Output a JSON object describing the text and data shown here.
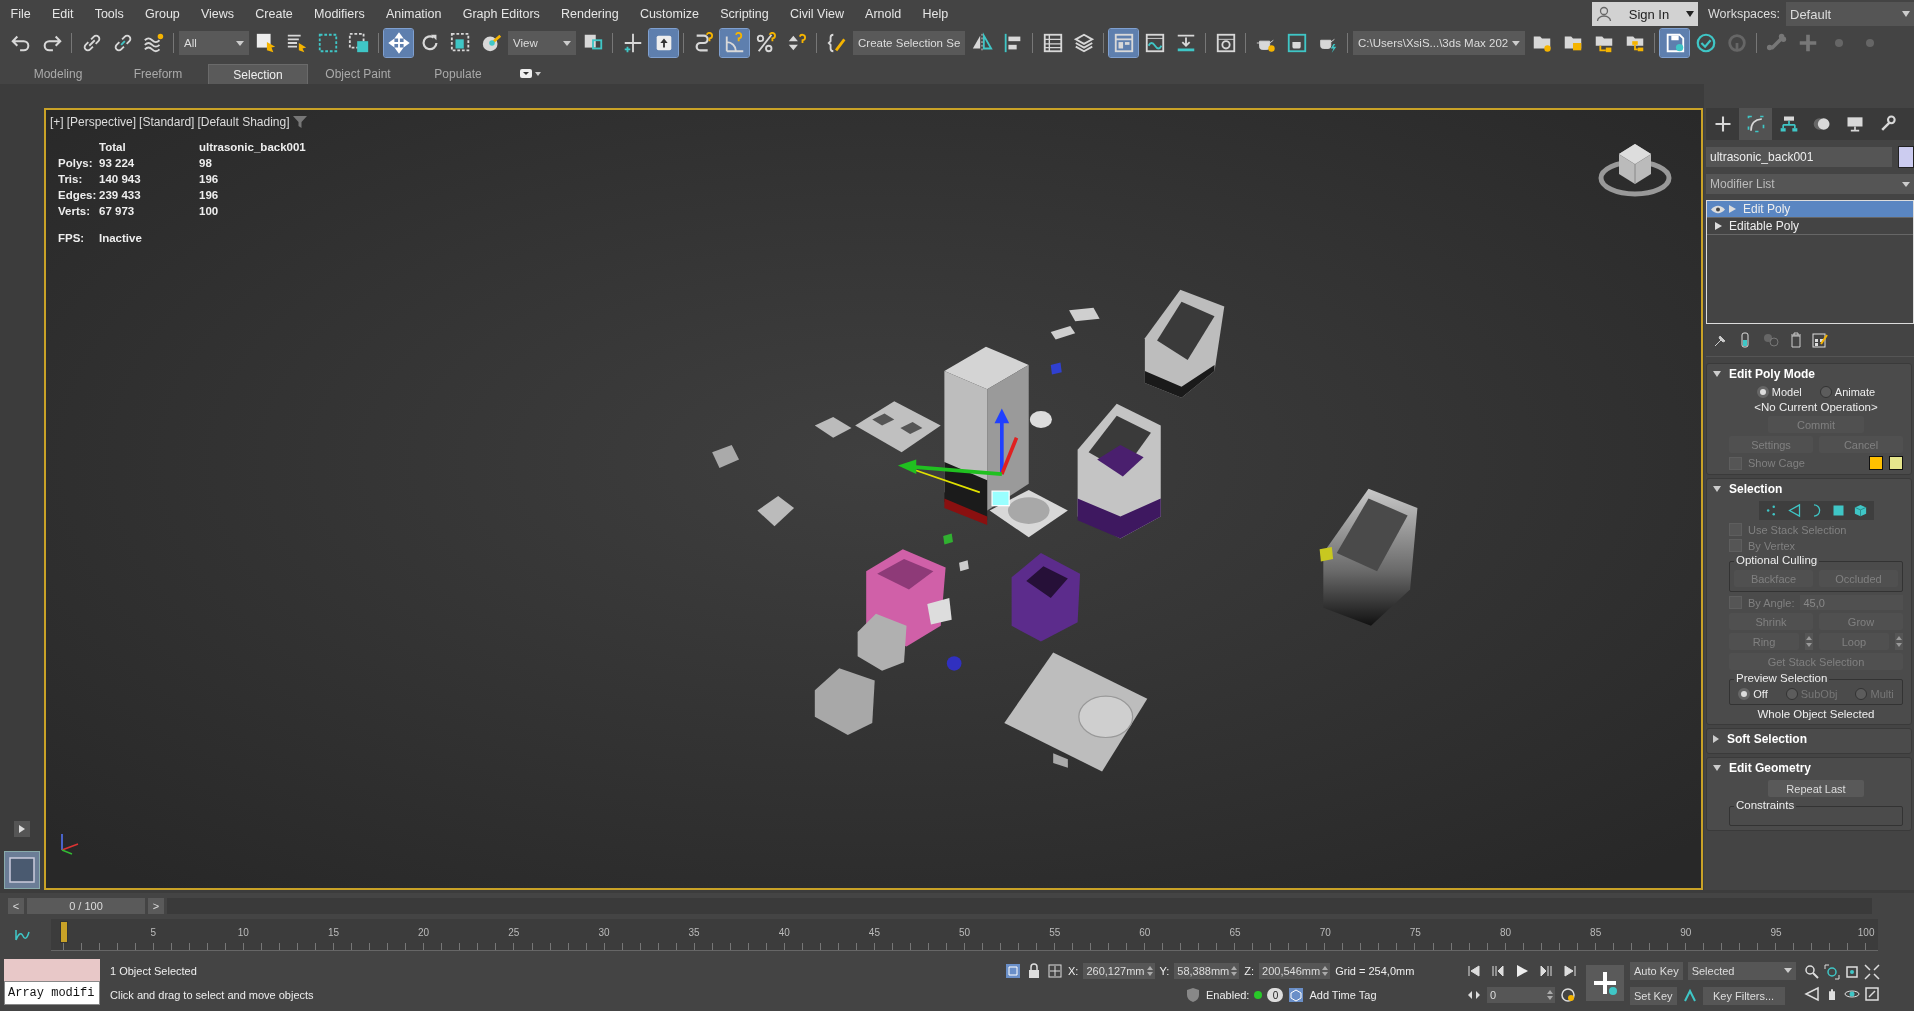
{
  "menu_bar": {
    "items": [
      "File",
      "Edit",
      "Tools",
      "Group",
      "Views",
      "Create",
      "Modifiers",
      "Animation",
      "Graph Editors",
      "Rendering",
      "Customize",
      "Scripting",
      "Civil View",
      "Arnold",
      "Help"
    ],
    "sign_in": "Sign In",
    "workspaces_label": "Workspaces:",
    "workspace": "Default"
  },
  "toolbar": [
    {
      "kind": "undo",
      "selected": false
    },
    {
      "kind": "redo",
      "selected": false
    },
    {
      "kind": "separator"
    },
    {
      "kind": "link",
      "selected": false
    },
    {
      "kind": "unlink",
      "selected": false
    },
    {
      "kind": "bind",
      "selected": false
    },
    {
      "kind": "separator"
    },
    {
      "kind": "dropdown",
      "value": "All"
    },
    {
      "kind": "select",
      "selected": false
    },
    {
      "kind": "select-by-name",
      "selected": false
    },
    {
      "kind": "rect-region",
      "selected": false
    },
    {
      "kind": "window-crossing",
      "selected": false
    },
    {
      "kind": "separator"
    },
    {
      "kind": "move",
      "selected": true
    },
    {
      "kind": "rotate",
      "selected": false
    },
    {
      "kind": "scale",
      "selected": false
    },
    {
      "kind": "place",
      "selected": false
    },
    {
      "kind": "dropdown",
      "value": "View"
    },
    {
      "kind": "pivot",
      "selected": false
    },
    {
      "kind": "separator"
    },
    {
      "kind": "axis-constraint",
      "selected": false
    },
    {
      "kind": "placement",
      "selected": true
    },
    {
      "kind": "separator"
    },
    {
      "kind": "snap",
      "selected": false
    },
    {
      "kind": "angle-snap",
      "selected": true
    },
    {
      "kind": "percent-snap",
      "selected": false
    },
    {
      "kind": "spinner-snap",
      "selected": false
    },
    {
      "kind": "separator"
    },
    {
      "kind": "named-selection",
      "selected": false
    },
    {
      "kind": "dropdown",
      "value": "Create Selection Se"
    },
    {
      "kind": "mirror",
      "selected": false
    },
    {
      "kind": "align",
      "selected": false
    },
    {
      "kind": "separator"
    },
    {
      "kind": "scene-explorer",
      "selected": false
    },
    {
      "kind": "layer-explorer",
      "selected": false
    },
    {
      "kind": "separator"
    },
    {
      "kind": "ribbon",
      "selected": true
    },
    {
      "kind": "curve-editor",
      "selected": false
    },
    {
      "kind": "schematic",
      "selected": false
    },
    {
      "kind": "separator"
    },
    {
      "kind": "render-setup",
      "selected": false
    },
    {
      "kind": "separator"
    },
    {
      "kind": "teapot-gear",
      "selected": false
    },
    {
      "kind": "teapot-window",
      "selected": false
    },
    {
      "kind": "teapot-bolt",
      "selected": false
    },
    {
      "kind": "separator"
    },
    {
      "kind": "dropdown",
      "value": "C:\\Users\\XsiS...\\3ds Max 202"
    },
    {
      "kind": "folder-gear",
      "selected": false
    },
    {
      "kind": "folder",
      "selected": false
    },
    {
      "kind": "folder-tree",
      "selected": false
    },
    {
      "kind": "folder-branches",
      "selected": false
    },
    {
      "kind": "separator"
    },
    {
      "kind": "floppy",
      "selected": true
    },
    {
      "kind": "check",
      "selected": false
    },
    {
      "kind": "circle-arrow",
      "selected": false
    },
    {
      "kind": "separator"
    },
    {
      "kind": "bone",
      "selected": false
    },
    {
      "kind": "plus",
      "selected": false
    },
    {
      "kind": "dot",
      "selected": false
    },
    {
      "kind": "dot",
      "selected": false
    }
  ],
  "ribbon_tabs": [
    {
      "label": "Modeling",
      "selected": false
    },
    {
      "label": "Freeform",
      "selected": false
    },
    {
      "label": "Selection",
      "selected": true
    },
    {
      "label": "Object Paint",
      "selected": false
    },
    {
      "label": "Populate",
      "selected": false
    }
  ],
  "viewport": {
    "active": true,
    "labels": [
      "[+]",
      "[Perspective]",
      "[Standard]",
      "[Default Shading]"
    ],
    "stats": {
      "columns": [
        "Total",
        "ultrasonic_back001"
      ],
      "rows": [
        {
          "label": "Polys:",
          "total": "93 224",
          "object": "98"
        },
        {
          "label": "Tris:",
          "total": "140 943",
          "object": "196"
        },
        {
          "label": "Edges:",
          "total": "239 433",
          "object": "196"
        },
        {
          "label": "Verts:",
          "total": "67 973",
          "object": "100"
        }
      ],
      "fps_label": "FPS:",
      "fps": "Inactive"
    }
  },
  "command_panel": {
    "tabs": [
      {
        "kind": "create",
        "selected": false
      },
      {
        "kind": "modify",
        "selected": true
      },
      {
        "kind": "hierarchy",
        "selected": false
      },
      {
        "kind": "motion",
        "selected": false
      },
      {
        "kind": "display",
        "selected": false
      },
      {
        "kind": "utilities",
        "selected": false
      }
    ],
    "object_name": "ultrasonic_back001",
    "object_swatch": {
      "color": "#ccccf0"
    },
    "modifier_list": "Modifier List",
    "stack": [
      {
        "label": "Edit Poly",
        "selected": true,
        "visible": true
      },
      {
        "label": "Editable Poly",
        "selected": false,
        "visible": false
      }
    ],
    "rollouts": [
      {
        "title": "Edit Poly Mode",
        "expanded": true,
        "controls": [
          {
            "kind": "radios",
            "options": [
              {
                "label": "Model",
                "selected": true,
                "disabled": false
              },
              {
                "label": "Animate",
                "selected": false,
                "disabled": false
              }
            ]
          },
          {
            "kind": "note",
            "text": "<No Current Operation>"
          },
          {
            "kind": "buttons",
            "items": [
              {
                "label": "Commit",
                "disabled": true
              }
            ]
          },
          {
            "kind": "buttons",
            "items": [
              {
                "label": "Settings",
                "disabled": true
              },
              {
                "label": "Cancel",
                "disabled": true
              }
            ]
          },
          {
            "kind": "checkbox",
            "label": "Show Cage",
            "checked": false,
            "disabled": true,
            "swatches": [
              {
                "color": "#ffc000"
              },
              {
                "color": "#e6e68c"
              }
            ]
          }
        ]
      },
      {
        "title": "Selection",
        "expanded": true,
        "controls": [
          {
            "kind": "subobjects",
            "items": [
              {
                "kind": "vertex",
                "selected": false
              },
              {
                "kind": "edge",
                "selected": false
              },
              {
                "kind": "border",
                "selected": false
              },
              {
                "kind": "polygon",
                "selected": false
              },
              {
                "kind": "element",
                "selected": false
              }
            ]
          },
          {
            "kind": "checkbox",
            "label": "Use Stack Selection",
            "checked": false,
            "disabled": true
          },
          {
            "kind": "checkbox",
            "label": "By Vertex",
            "checked": false,
            "disabled": true
          },
          {
            "kind": "group",
            "title": "Optional Culling",
            "controls": [
              {
                "kind": "buttons",
                "items": [
                  {
                    "label": "Backface",
                    "disabled": true
                  },
                  {
                    "label": "Occluded",
                    "disabled": true
                  }
                ]
              }
            ]
          },
          {
            "kind": "checkbox",
            "label": "By Angle:",
            "checked": false,
            "disabled": true,
            "value": "45,0"
          },
          {
            "kind": "buttons",
            "items": [
              {
                "label": "Shrink",
                "disabled": true
              },
              {
                "label": "Grow",
                "disabled": true
              }
            ]
          },
          {
            "kind": "buttons",
            "items": [
              {
                "label": "Ring",
                "disabled": true,
                "spinner": true
              },
              {
                "label": "Loop",
                "disabled": true,
                "spinner": true
              }
            ]
          },
          {
            "kind": "buttons",
            "items": [
              {
                "label": "Get Stack Selection",
                "disabled": true
              }
            ]
          },
          {
            "kind": "group",
            "title": "Preview Selection",
            "controls": [
              {
                "kind": "radios",
                "options": [
                  {
                    "label": "Off",
                    "selected": true,
                    "disabled": false
                  },
                  {
                    "label": "SubObj",
                    "selected": false,
                    "disabled": true
                  },
                  {
                    "label": "Multi",
                    "selected": false,
                    "disabled": true
                  }
                ]
              }
            ]
          },
          {
            "kind": "note",
            "text": "Whole Object Selected"
          }
        ]
      },
      {
        "title": "Soft Selection",
        "expanded": false
      },
      {
        "title": "Edit Geometry",
        "expanded": true,
        "controls": [
          {
            "kind": "buttons",
            "items": [
              {
                "label": "Repeat Last",
                "disabled": false
              }
            ]
          },
          {
            "kind": "group",
            "title": "Constraints"
          }
        ]
      }
    ]
  },
  "timeline": {
    "prev": "<",
    "frame": "0 / 100",
    "next": ">",
    "ticks": [
      "5",
      "10",
      "15",
      "20",
      "25",
      "30",
      "35",
      "40",
      "45",
      "50",
      "55",
      "60",
      "65",
      "70",
      "75",
      "80",
      "85",
      "90",
      "95",
      "100"
    ]
  },
  "status_bar": {
    "listener_output": "Array modifi",
    "selection": "1 Object Selected",
    "prompt": "Click and drag to select and move objects",
    "coords": [
      {
        "axis": "X:",
        "value": "260,127mm"
      },
      {
        "axis": "Y:",
        "value": "58,388mm"
      },
      {
        "axis": "Z:",
        "value": "200,546mm"
      }
    ],
    "grid": "Grid = 254,0mm",
    "enabled_label": "Enabled:",
    "enabled": true,
    "tag_count": "0",
    "add_time_tag": "Add Time Tag",
    "frame": "0",
    "auto_key": "Auto Key",
    "key_mode": "Selected",
    "set_key": "Set Key",
    "key_filters": "Key Filters..."
  }
}
